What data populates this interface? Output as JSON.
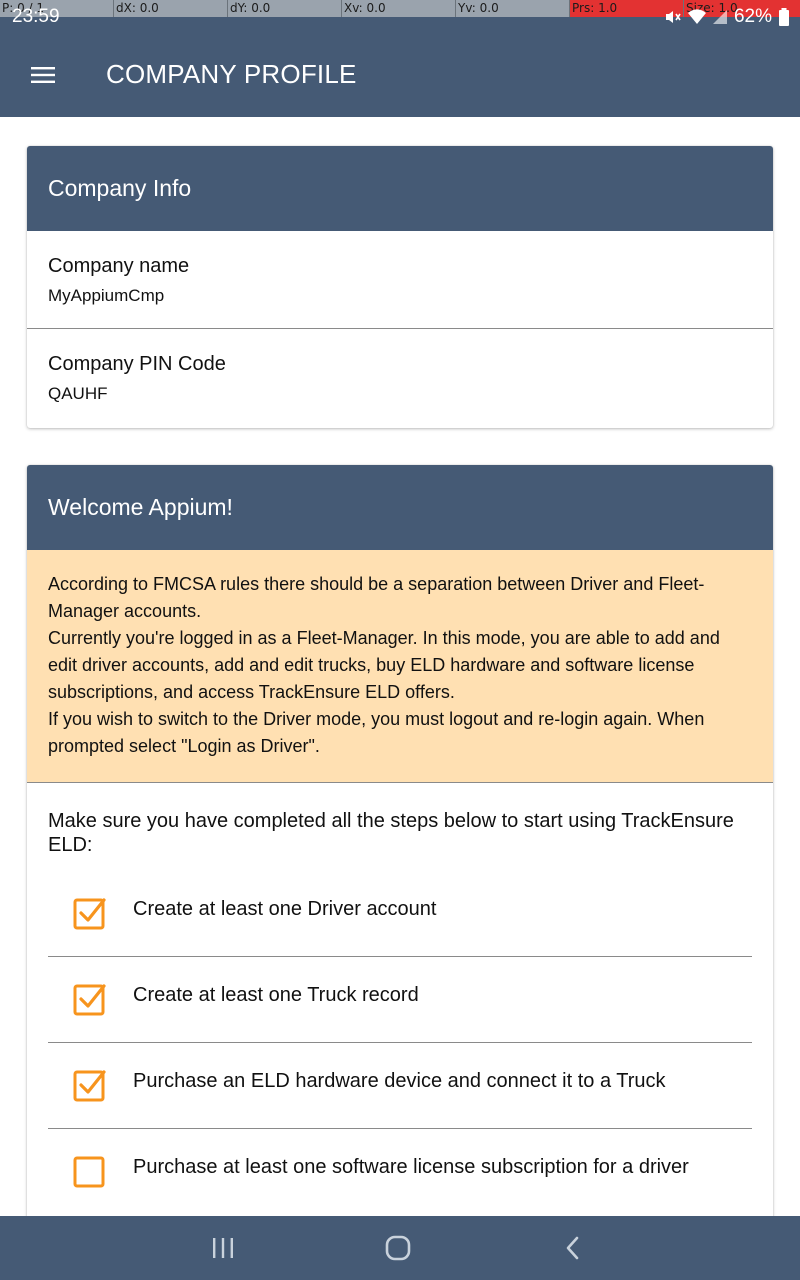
{
  "debug": {
    "p": "P: 0 / 1",
    "dx": "dX: 0.0",
    "dy": "dY: 0.0",
    "xv": "Xv: 0.0",
    "yv": "Yv: 0.0",
    "prs": "Prs: 1.0",
    "size": "Size: 1.0"
  },
  "status": {
    "time": "23:59",
    "battery": "62%",
    "icons": [
      "mute-icon",
      "wifi-icon",
      "signal-icon",
      "battery-icon"
    ]
  },
  "app_bar": {
    "title": "COMPANY PROFILE",
    "menu_icon": "hamburger-menu-icon"
  },
  "company_info": {
    "header": "Company Info",
    "rows": [
      {
        "label": "Company name",
        "value": "MyAppiumCmp"
      },
      {
        "label": "Company PIN Code",
        "value": "QAUHF"
      }
    ]
  },
  "welcome": {
    "header": "Welcome Appium!",
    "notice_lines": [
      "According to FMCSA rules there should be a separation between Driver and Fleet-Manager accounts.",
      "Currently you're logged in as a Fleet-Manager. In this mode, you are able to add and edit driver accounts, add and edit trucks, buy ELD hardware and software license subscriptions, and access TrackEnsure ELD offers.",
      "If you wish to switch to the Driver mode, you must logout and re-login again. When prompted select \"Login as Driver\"."
    ],
    "steps_intro": "Make sure you have completed all the steps below to start using TrackEnsure ELD:",
    "steps": [
      {
        "label": "Create at least one Driver account",
        "checked": true
      },
      {
        "label": "Create at least one Truck record",
        "checked": true
      },
      {
        "label": "Purchase an ELD hardware device and connect it to a Truck",
        "checked": true
      },
      {
        "label": "Purchase at least one software license subscription for a driver",
        "checked": false
      }
    ]
  },
  "nav": {
    "items": [
      "recent-apps-icon",
      "home-icon",
      "back-icon"
    ]
  },
  "colors": {
    "primary": "#455a75",
    "notice_bg": "#ffe0b2",
    "checkbox": "#f7941d"
  }
}
